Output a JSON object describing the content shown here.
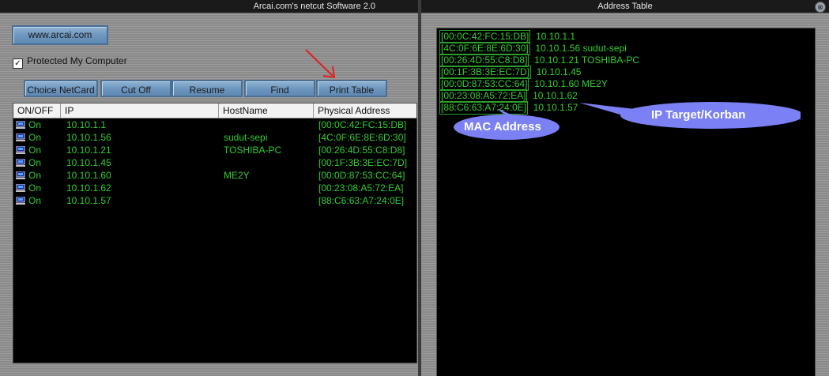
{
  "left_window": {
    "title": "Arcai.com's netcut Software 2.0",
    "website_button": "www.arcai.com",
    "protected_label": "Protected My Computer",
    "protected_checked": true,
    "toolbar": {
      "choice_netcard": "Choice NetCard",
      "cut_off": "Cut Off",
      "resume": "Resume",
      "find": "Find",
      "print_table": "Print Table"
    },
    "table": {
      "headers": [
        "ON/OFF",
        "IP",
        "HostName",
        "Physical Address"
      ],
      "rows": [
        {
          "status": "On",
          "ip": "10.10.1.1",
          "host": "",
          "mac": "[00:0C:42:FC:15:DB]"
        },
        {
          "status": "On",
          "ip": "10.10.1.56",
          "host": "sudut-sepi",
          "mac": "[4C:0F:6E:8E:6D:30]"
        },
        {
          "status": "On",
          "ip": "10.10.1.21",
          "host": "TOSHIBA-PC",
          "mac": "[00:26:4D:55:C8:D8]"
        },
        {
          "status": "On",
          "ip": "10.10.1.45",
          "host": "",
          "mac": "[00:1F:3B:3E:EC:7D]"
        },
        {
          "status": "On",
          "ip": "10.10.1.60",
          "host": "ME2Y",
          "mac": "[00:0D:87:53:CC:64]"
        },
        {
          "status": "On",
          "ip": "10.10.1.62",
          "host": "",
          "mac": "[00:23:08:A5:72:EA]"
        },
        {
          "status": "On",
          "ip": "10.10.1.57",
          "host": "",
          "mac": "[88:C6:63:A7:24:0E]"
        }
      ]
    }
  },
  "right_window": {
    "title": "Address Table",
    "close_icon": "close-icon",
    "entries": [
      {
        "mac": "[00:0C:42:FC:15:DB]",
        "ip": "10.10.1.1",
        "host": ""
      },
      {
        "mac": "[4C:0F:6E:8E:6D:30]",
        "ip": "10.10.1.56",
        "host": "sudut-sepi"
      },
      {
        "mac": "[00:26:4D:55:C8:D8]",
        "ip": "10.10.1.21",
        "host": "TOSHIBA-PC"
      },
      {
        "mac": "[00:1F:3B:3E:EC:7D]",
        "ip": "10.10.1.45",
        "host": ""
      },
      {
        "mac": "[00:0D:87:53:CC:64]",
        "ip": "10.10.1.60",
        "host": "ME2Y"
      },
      {
        "mac": "[00:23:08:A5:72:EA]",
        "ip": "10.10.1.62",
        "host": ""
      },
      {
        "mac": "[88:C6:63:A7:24:0E]",
        "ip": "10.10.1.57",
        "host": ""
      }
    ]
  },
  "annotations": {
    "mac_label": "MAC Address",
    "ip_label": "IP Target/Korban"
  },
  "colors": {
    "terminal_green": "#33cc33",
    "callout_fill": "#7b80f4",
    "arrow_red": "#e02020",
    "button_blue": "#6f97bf"
  }
}
